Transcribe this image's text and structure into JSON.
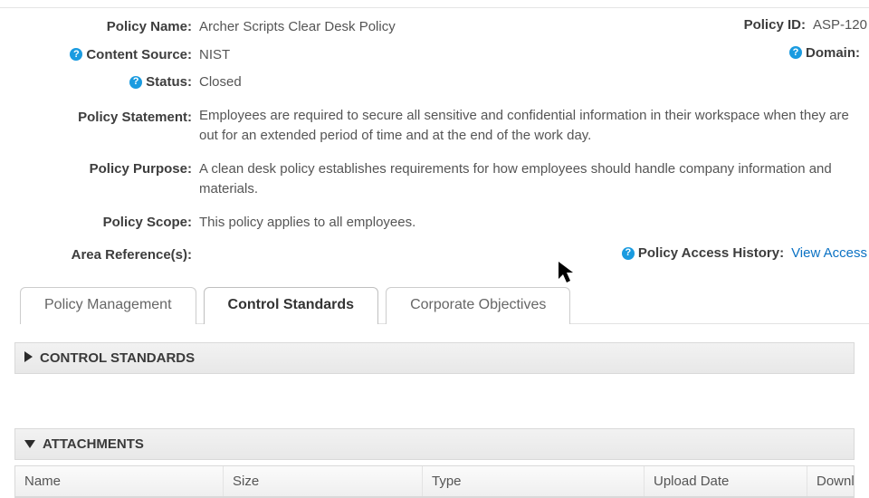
{
  "fields": {
    "policy_name": {
      "label": "Policy Name:",
      "value": "Archer Scripts Clear Desk Policy"
    },
    "policy_id": {
      "label": "Policy ID:",
      "value": "ASP-120"
    },
    "content_source": {
      "label": "Content Source:",
      "value": "NIST"
    },
    "domain": {
      "label": "Domain:",
      "value": ""
    },
    "status": {
      "label": "Status:",
      "value": "Closed"
    },
    "policy_statement": {
      "label": "Policy Statement:",
      "value": "Employees are required to secure all sensitive and confidential information in their workspace when they are out for an extended period of time and at the end of the work day."
    },
    "policy_purpose": {
      "label": "Policy Purpose:",
      "value": "A clean desk policy establishes requirements for how employees should handle company information and materials."
    },
    "policy_scope": {
      "label": "Policy Scope:",
      "value": "This policy applies to all employees."
    },
    "area_references": {
      "label": "Area Reference(s):",
      "value": ""
    },
    "access_history": {
      "label": "Policy Access History:",
      "link": "View Access"
    }
  },
  "tabs": {
    "policy_management": "Policy Management",
    "control_standards": "Control Standards",
    "corporate_objectives": "Corporate Objectives",
    "active": "control_standards"
  },
  "sections": {
    "control_standards": "CONTROL STANDARDS",
    "attachments": "ATTACHMENTS"
  },
  "attachments_table": {
    "headers": {
      "name": "Name",
      "size": "Size",
      "type": "Type",
      "upload_date": "Upload Date",
      "download": "Downl"
    }
  }
}
